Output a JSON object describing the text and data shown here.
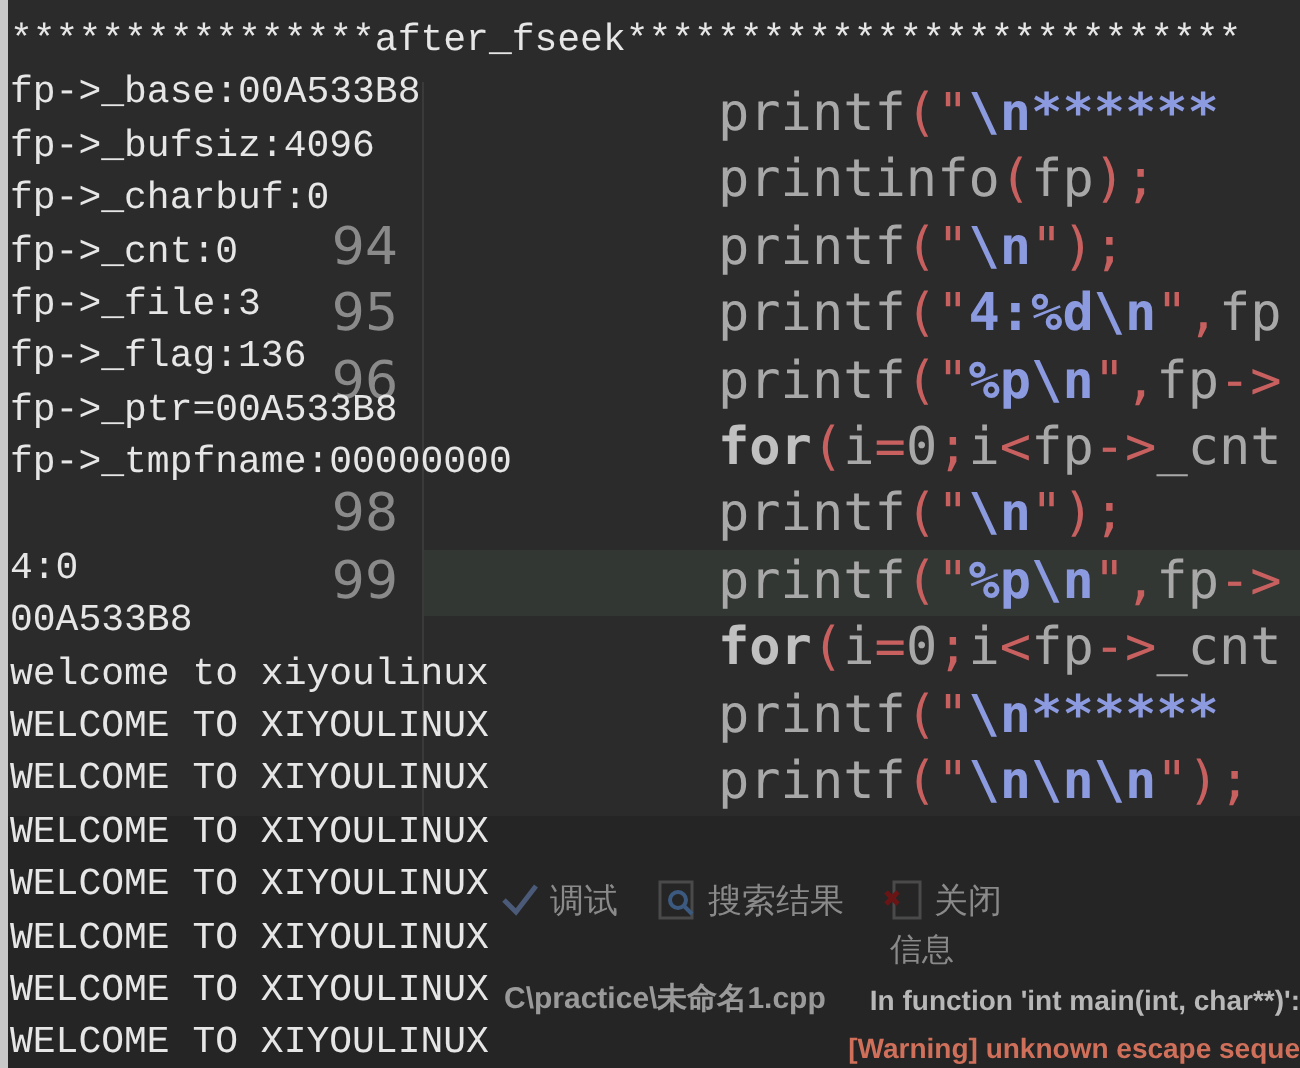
{
  "editor": {
    "lines": [
      {
        "highlighted": false,
        "tokens": [
          {
            "kind": "plain",
            "text": "printf"
          },
          {
            "kind": "punct",
            "text": "(\""
          },
          {
            "kind": "string",
            "text": "\\n******"
          }
        ]
      },
      {
        "highlighted": false,
        "tokens": [
          {
            "kind": "plain",
            "text": "printinfo"
          },
          {
            "kind": "punct",
            "text": "("
          },
          {
            "kind": "plain",
            "text": "fp"
          },
          {
            "kind": "punct",
            "text": ");"
          }
        ]
      },
      {
        "number": "94",
        "highlighted": false,
        "tokens": [
          {
            "kind": "plain",
            "text": "printf"
          },
          {
            "kind": "punct",
            "text": "(\""
          },
          {
            "kind": "string",
            "text": "\\n"
          },
          {
            "kind": "punct",
            "text": "\");"
          }
        ]
      },
      {
        "number": "95",
        "highlighted": false,
        "tokens": [
          {
            "kind": "plain",
            "text": "printf"
          },
          {
            "kind": "punct",
            "text": "(\""
          },
          {
            "kind": "string",
            "text": "4:%d\\n"
          },
          {
            "kind": "punct",
            "text": "\","
          },
          {
            "kind": "plain",
            "text": "fp"
          }
        ]
      },
      {
        "number": "96",
        "highlighted": false,
        "tokens": [
          {
            "kind": "plain",
            "text": "printf"
          },
          {
            "kind": "punct",
            "text": "(\""
          },
          {
            "kind": "string",
            "text": "%p\\n"
          },
          {
            "kind": "punct",
            "text": "\","
          },
          {
            "kind": "plain",
            "text": "fp"
          },
          {
            "kind": "punct",
            "text": "->"
          }
        ]
      },
      {
        "highlighted": false,
        "tokens": [
          {
            "kind": "keyword",
            "text": "for"
          },
          {
            "kind": "punct",
            "text": "("
          },
          {
            "kind": "plain",
            "text": "i"
          },
          {
            "kind": "punct",
            "text": "="
          },
          {
            "kind": "plain",
            "text": "0"
          },
          {
            "kind": "punct",
            "text": ";"
          },
          {
            "kind": "plain",
            "text": "i"
          },
          {
            "kind": "punct",
            "text": "<"
          },
          {
            "kind": "plain",
            "text": "fp"
          },
          {
            "kind": "punct",
            "text": "->"
          },
          {
            "kind": "plain",
            "text": "_cnt"
          }
        ]
      },
      {
        "number": "98",
        "highlighted": false,
        "tokens": [
          {
            "kind": "plain",
            "text": "printf"
          },
          {
            "kind": "punct",
            "text": "(\""
          },
          {
            "kind": "string",
            "text": "\\n"
          },
          {
            "kind": "punct",
            "text": "\");"
          }
        ]
      },
      {
        "number": "99",
        "highlighted": true,
        "tokens": [
          {
            "kind": "plain",
            "text": "printf"
          },
          {
            "kind": "punct",
            "text": "(\""
          },
          {
            "kind": "string",
            "text": "%p\\n"
          },
          {
            "kind": "punct",
            "text": "\","
          },
          {
            "kind": "plain",
            "text": "fp"
          },
          {
            "kind": "punct",
            "text": "->"
          }
        ]
      },
      {
        "highlighted": false,
        "tokens": [
          {
            "kind": "keyword",
            "text": "for"
          },
          {
            "kind": "punct",
            "text": "("
          },
          {
            "kind": "plain",
            "text": "i"
          },
          {
            "kind": "punct",
            "text": "="
          },
          {
            "kind": "plain",
            "text": "0"
          },
          {
            "kind": "punct",
            "text": ";"
          },
          {
            "kind": "plain",
            "text": "i"
          },
          {
            "kind": "punct",
            "text": "<"
          },
          {
            "kind": "plain",
            "text": "fp"
          },
          {
            "kind": "punct",
            "text": "->"
          },
          {
            "kind": "plain",
            "text": "_cnt"
          }
        ]
      },
      {
        "highlighted": false,
        "tokens": [
          {
            "kind": "plain",
            "text": "printf"
          },
          {
            "kind": "punct",
            "text": "(\""
          },
          {
            "kind": "string",
            "text": "\\n******"
          }
        ]
      },
      {
        "highlighted": false,
        "tokens": [
          {
            "kind": "plain",
            "text": "printf"
          },
          {
            "kind": "punct",
            "text": "(\""
          },
          {
            "kind": "string",
            "text": "\\n\\n\\n"
          },
          {
            "kind": "punct",
            "text": "\");"
          }
        ]
      }
    ]
  },
  "bottom_panel": {
    "tabs": [
      {
        "kind": "check",
        "label": "调试"
      },
      {
        "kind": "search",
        "label": "搜索结果"
      },
      {
        "kind": "close",
        "label": "关闭"
      }
    ],
    "columns": [
      "信息"
    ],
    "messages": [
      {
        "kind": "file",
        "file": "C\\practice\\未命名1.cpp",
        "message": "In function 'int main(int, char**)':"
      },
      {
        "kind": "warning",
        "message": "[Warning] unknown escape seque"
      }
    ]
  },
  "console": {
    "blocks": [
      {
        "lines": [
          "****************after_fseek***************************",
          "fp->_base:00A533B8",
          "fp->_bufsiz:4096",
          "fp->_charbuf:0",
          "fp->_cnt:0",
          "fp->_file:3",
          "fp->_flag:136",
          "fp->_ptr=00A533B8",
          "fp->_tmpfname:00000000"
        ]
      },
      {
        "lines": [
          "4:0",
          "00A533B8",
          "welcome to xiyoulinux",
          "WELCOME TO XIYOULINUX",
          "WELCOME TO XIYOULINUX",
          "WELCOME TO XIYOULINUX",
          "WELCOME TO XIYOULINUX",
          "WELCOME TO XIYOULINUX",
          "WELCOME TO XIYOULINUX",
          "WELCOME TO XIYOULINUX"
        ]
      }
    ]
  }
}
